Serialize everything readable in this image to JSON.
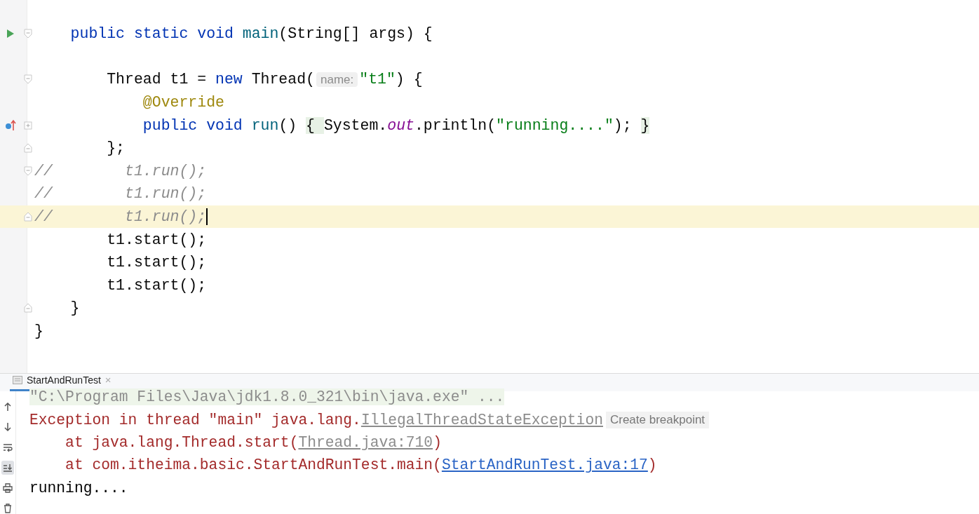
{
  "editor": {
    "lines": [
      {
        "markers": [
          {
            "kind": "run"
          },
          {
            "kind": "fold-open"
          }
        ],
        "current": false,
        "tokens": [
          {
            "kind": "kw",
            "text": "    public static void "
          },
          {
            "kind": "fn",
            "text": "main"
          },
          {
            "kind": "plain",
            "text": "(String[] args) {"
          }
        ]
      },
      {
        "current": false
      },
      {
        "markers": [
          {
            "kind": "fold-open"
          }
        ],
        "current": false,
        "tokens": [
          {
            "kind": "plain",
            "text": "        Thread t1 = "
          },
          {
            "kind": "kw",
            "text": "new "
          },
          {
            "kind": "plain",
            "text": "Thread("
          },
          {
            "kind": "hint",
            "text": "name:"
          },
          {
            "kind": "str",
            "text": "\"t1\""
          },
          {
            "kind": "plain",
            "text": ") {"
          }
        ]
      },
      {
        "current": false,
        "tokens": [
          {
            "kind": "annot",
            "text": "            @Override"
          }
        ]
      },
      {
        "markers": [
          {
            "kind": "override"
          },
          {
            "kind": "fold-collapsed"
          }
        ],
        "current": false,
        "tokens": [
          {
            "kind": "kw",
            "text": "            public void "
          },
          {
            "kind": "fn",
            "text": "run"
          },
          {
            "kind": "plain",
            "text": "() "
          },
          {
            "kind": "folded",
            "text": "{ "
          },
          {
            "kind": "plain",
            "text": "System."
          },
          {
            "kind": "field",
            "text": "out"
          },
          {
            "kind": "plain",
            "text": ".println("
          },
          {
            "kind": "str",
            "text": "\"running....\""
          },
          {
            "kind": "plain",
            "text": "); "
          },
          {
            "kind": "folded",
            "text": "}"
          }
        ]
      },
      {
        "markers": [
          {
            "kind": "fold-close"
          }
        ],
        "current": false,
        "tokens": [
          {
            "kind": "plain",
            "text": "        };"
          }
        ]
      },
      {
        "markers": [
          {
            "kind": "fold-open"
          }
        ],
        "current": false,
        "tokens": [
          {
            "kind": "comment",
            "text": "//        t1.run();"
          }
        ]
      },
      {
        "current": false,
        "tokens": [
          {
            "kind": "comment",
            "text": "//        t1.run();"
          }
        ]
      },
      {
        "markers": [
          {
            "kind": "fold-close"
          }
        ],
        "current": true,
        "tokens": [
          {
            "kind": "comment",
            "text": "//        t1.run();"
          }
        ]
      },
      {
        "current": false,
        "tokens": [
          {
            "kind": "plain",
            "text": "        t1.start();"
          }
        ]
      },
      {
        "current": false,
        "tokens": [
          {
            "kind": "plain",
            "text": "        t1.start();"
          }
        ]
      },
      {
        "current": false,
        "tokens": [
          {
            "kind": "plain",
            "text": "        t1.start();"
          }
        ]
      },
      {
        "markers": [
          {
            "kind": "fold-close"
          }
        ],
        "current": false,
        "tokens": [
          {
            "kind": "plain",
            "text": "    }"
          }
        ]
      },
      {
        "current": false,
        "tokens": [
          {
            "kind": "plain",
            "text": "}"
          }
        ]
      }
    ]
  },
  "console": {
    "tab": {
      "label": "StartAndRunTest",
      "close": "×",
      "selected": true
    },
    "toolbar": [
      {
        "kind": "up",
        "selected": false
      },
      {
        "kind": "down",
        "selected": false
      },
      {
        "kind": "wrap",
        "selected": false
      },
      {
        "kind": "scroll-end",
        "selected": true
      },
      {
        "kind": "print",
        "selected": false
      },
      {
        "kind": "trash",
        "selected": false
      }
    ],
    "lines": [
      {
        "tokens": [
          {
            "kind": "cmd",
            "text": "\"C:\\Program Files\\Java\\jdk1.8.0_321\\bin\\java.exe\" ..."
          }
        ]
      },
      {
        "tokens": [
          {
            "kind": "error",
            "text": "Exception in thread \"main\" java.lang."
          },
          {
            "kind": "grey-link",
            "text": "IllegalThreadStateException"
          }
        ],
        "tooltip": "Create breakpoint"
      },
      {
        "tokens": [
          {
            "kind": "error",
            "text": "    at java.lang.Thread.start("
          },
          {
            "kind": "grey-link",
            "text": "Thread.java:710"
          },
          {
            "kind": "error",
            "text": ")"
          }
        ]
      },
      {
        "tokens": [
          {
            "kind": "error",
            "text": "    at com.itheima.basic.StartAndRunTest.main("
          },
          {
            "kind": "link",
            "text": "StartAndRunTest.java:17"
          },
          {
            "kind": "error",
            "text": ")"
          }
        ]
      },
      {
        "tokens": [
          {
            "kind": "plain",
            "text": "running...."
          }
        ]
      }
    ]
  }
}
